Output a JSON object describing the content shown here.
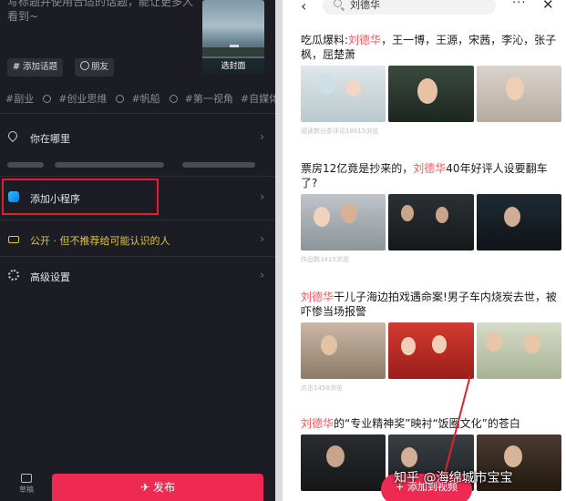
{
  "left": {
    "description": "写标题并使用合适的话题，能让更多人看到~",
    "cover_label": "选封面",
    "chips": {
      "topic": "添加话题",
      "friend": "朋友",
      "topic_glyph": "#"
    },
    "tags": [
      "#副业",
      "#创业思维",
      "#帆船",
      "#第一视角",
      "#自媒体"
    ],
    "location": "你在哪里",
    "mini_program": "添加小程序",
    "privacy": "公开 · 但不推荐给可能认识的人",
    "advanced": "高级设置",
    "publish": "发布",
    "draft": "草稿",
    "chevron": "›",
    "publish_glyph": "✈"
  },
  "right": {
    "search_query": "刘德华",
    "back_glyph": "‹",
    "more_glyph": "···",
    "close_glyph": "✕",
    "articles": [
      {
        "title_pre": "吃瓜爆料:",
        "title_hl": "刘德华",
        "title_post": "，王一博，王源，宋茜，李沁，张子枫，屈楚萧",
        "meta": "阅读数分条评论16015浏览"
      },
      {
        "title_pre": "票房12亿竟是抄来的，",
        "title_hl": "刘德华",
        "title_post": "40年好评人设要翻车了?",
        "meta": "作品数3415浏览"
      },
      {
        "title_pre": "",
        "title_hl": "刘德华",
        "title_post": "干儿子海边拍戏遇命案!男子车内烧炭去世，被吓惨当场报警",
        "meta": "点击1458浏览"
      },
      {
        "title_pre": "",
        "title_hl": "刘德华",
        "title_post": "的“专业精神奖”映衬“饭圈文化”的苍白",
        "meta": ""
      }
    ],
    "fab_label": "添加到视频",
    "fab_glyph": "+",
    "watermark": "知乎 @海绵城市宝宝"
  },
  "colors": {
    "accent_red": "#ee2a52",
    "highlight_border": "#e02030",
    "keyword_red": "#f0585a",
    "lock_yellow": "#e2c23e"
  }
}
